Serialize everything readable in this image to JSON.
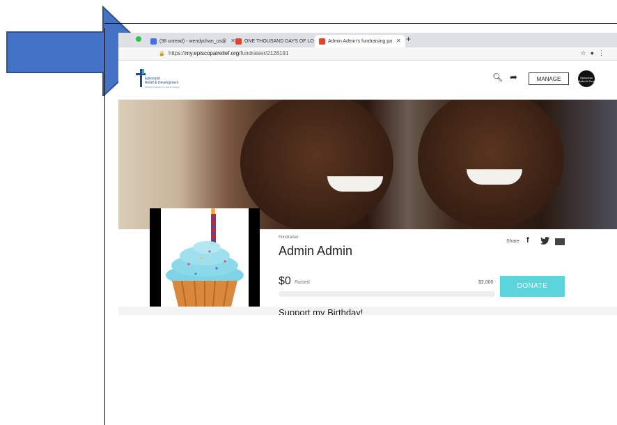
{
  "browser": {
    "tabs": [
      {
        "label": "(38 unread) - wendychan_us@",
        "icon": "mail-icon",
        "color": "#4a6ee0"
      },
      {
        "label": "ONE THOUSAND DAYS OF LO",
        "icon": "site-icon",
        "color": "#e0462f"
      },
      {
        "label": "Admin Admin's fundraising pa",
        "icon": "site-icon",
        "color": "#e0462f"
      }
    ],
    "url_prefix": "https://",
    "url_domain": "my.episcopalrelief.org",
    "url_path": "/fundraiser/2128191"
  },
  "header": {
    "logo_line1": "Episcopal",
    "logo_line2": "Relief & Development",
    "logo_tagline": "Working Together for Lasting Change",
    "manage_label": "MANAGE",
    "avatar_text": "Episcopal Relief & Devt"
  },
  "fundraiser": {
    "label": "Fundraiser",
    "name": "Admin Admin",
    "share_label": "Share",
    "raised_amount": "$0",
    "raised_label": "Raised",
    "goal": "$2,000",
    "progress": 0,
    "donate_label": "DONATE",
    "story_title": "Support my Birthday!"
  },
  "colors": {
    "donate": "#5bd4dc",
    "arrow": "#4472c4",
    "arrow_border": "#2f528f"
  }
}
